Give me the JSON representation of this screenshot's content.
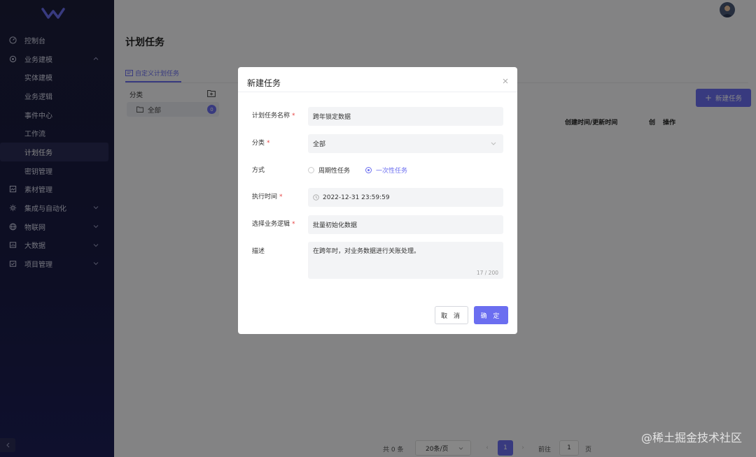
{
  "sidebar": {
    "items": [
      {
        "label": "控制台",
        "icon": "dashboard-icon"
      },
      {
        "label": "业务建模",
        "icon": "model-icon",
        "expanded": true
      },
      {
        "label": "实体建模",
        "sub": true
      },
      {
        "label": "业务逻辑",
        "sub": true
      },
      {
        "label": "事件中心",
        "sub": true
      },
      {
        "label": "工作流",
        "sub": true
      },
      {
        "label": "计划任务",
        "sub": true,
        "active": true
      },
      {
        "label": "密钥管理",
        "sub": true
      },
      {
        "label": "素材管理",
        "icon": "material-icon"
      },
      {
        "label": "集成与自动化",
        "icon": "integration-icon",
        "expandable": true
      },
      {
        "label": "物联网",
        "icon": "globe-icon",
        "expandable": true
      },
      {
        "label": "大数据",
        "icon": "bigdata-icon",
        "expandable": true
      },
      {
        "label": "项目管理",
        "icon": "project-icon",
        "expandable": true
      }
    ]
  },
  "main": {
    "page_title": "计划任务",
    "tab_label": "自定义计划任务",
    "category_header": "分类",
    "category_all": "全部",
    "category_count": "0",
    "new_task_button": "新建任务",
    "columns": [
      "创建时间/更新时间",
      "创",
      "操作"
    ],
    "pager": {
      "total": "共 0 条",
      "page_size": "20条/页",
      "current_page": "1",
      "goto_label": "前往",
      "goto_value": "1",
      "page_unit": "页"
    }
  },
  "modal": {
    "title": "新建任务",
    "fields": {
      "name_label": "计划任务名称",
      "name_value": "跨年锁定数据",
      "category_label": "分类",
      "category_value": "全部",
      "mode_label": "方式",
      "mode_option_periodic": "周期性任务",
      "mode_option_once": "一次性任务",
      "exec_time_label": "执行时间",
      "exec_time_value": "2022-12-31 23:59:59",
      "logic_label": "选择业务逻辑",
      "logic_value": "批量初始化数据",
      "desc_label": "描述",
      "desc_value": "在跨年时，对业务数据进行关账处理。",
      "desc_count": "17 / 200"
    },
    "cancel_button": "取 消",
    "ok_button": "确 定"
  },
  "watermark": "@稀土掘金技术社区",
  "colors": {
    "accent": "#6b6ef0",
    "sidebar_bg": "#1b1d3a",
    "required": "#e64545"
  }
}
